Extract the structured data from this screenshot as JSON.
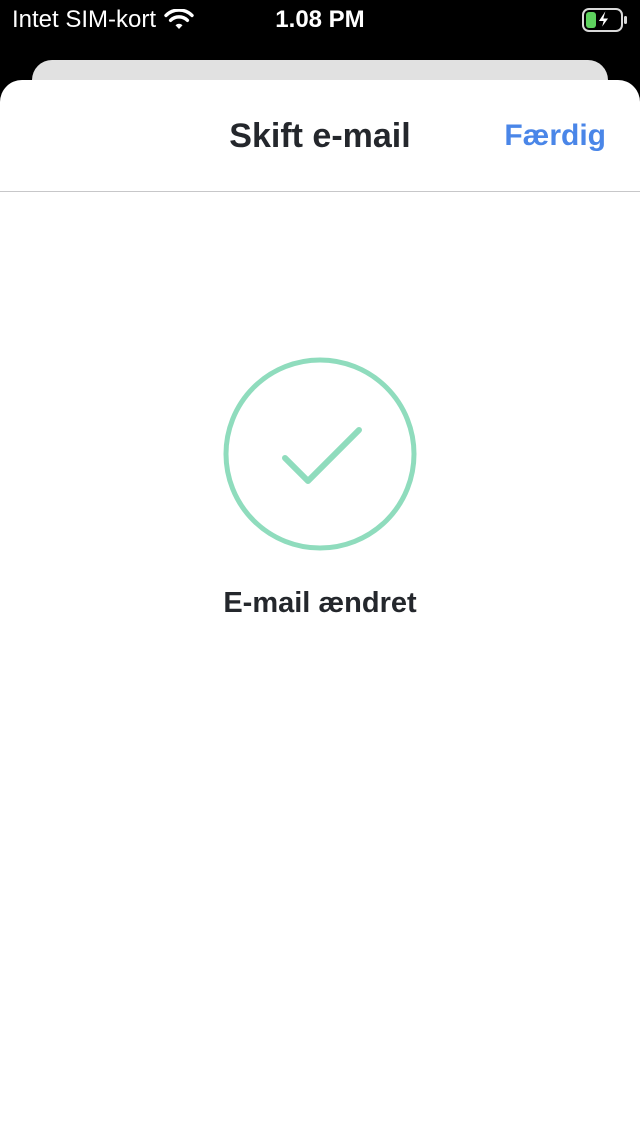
{
  "status_bar": {
    "carrier": "Intet SIM-kort",
    "time": "1.08 PM",
    "icons": [
      "wifi-icon",
      "battery-charging-icon"
    ]
  },
  "nav": {
    "title": "Skift e-mail",
    "done_label": "Færdig"
  },
  "content": {
    "icon": "checkmark-circle-icon",
    "message": "E-mail ændret"
  },
  "colors": {
    "accent": "#4a86e8",
    "success": "#8fdcbd",
    "text": "#24272c",
    "battery": "#5ed25e"
  }
}
